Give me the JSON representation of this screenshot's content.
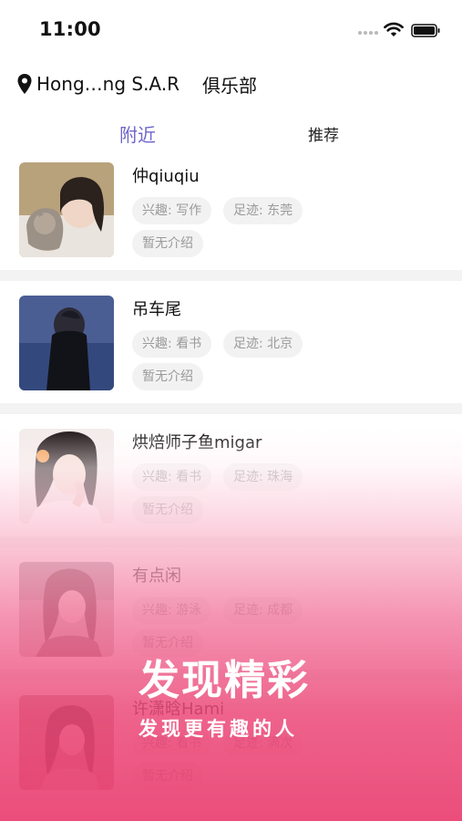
{
  "status_bar": {
    "time": "11:00",
    "icons": [
      "signal-dots-icon",
      "wifi-icon",
      "battery-icon"
    ]
  },
  "header": {
    "location_icon": "location-pin-icon",
    "location": "Hong…ng S.A.R",
    "club": "俱乐部"
  },
  "tabs": [
    {
      "label": "附近",
      "active": true
    },
    {
      "label": "推荐",
      "active": false
    }
  ],
  "users": [
    {
      "name": "仲qiuqiu",
      "interest": "兴趣: 写作",
      "trace": "足迹: 东莞",
      "intro": "暂无介绍"
    },
    {
      "name": "吊车尾",
      "interest": "兴趣: 看书",
      "trace": "足迹: 北京",
      "intro": "暂无介绍"
    },
    {
      "name": "烘焙师子鱼migar",
      "interest": "兴趣: 看书",
      "trace": "足迹: 珠海",
      "intro": "暂无介绍"
    },
    {
      "name": "有点闲",
      "interest": "兴趣: 游泳",
      "trace": "足迹: 成都",
      "intro": "暂无介绍"
    },
    {
      "name": "许潇晗Hami",
      "interest": "兴趣: 看书",
      "trace": "足迹: 满次",
      "intro": "暂无介绍"
    }
  ],
  "promo": {
    "title": "发现精彩",
    "subtitle": "发现更有趣的人"
  },
  "colors": {
    "active_tab": "#6d66c9",
    "tag_bg": "#f2f2f2",
    "tag_text": "#9a9a9a",
    "overlay_pink": "#ea3e70"
  }
}
